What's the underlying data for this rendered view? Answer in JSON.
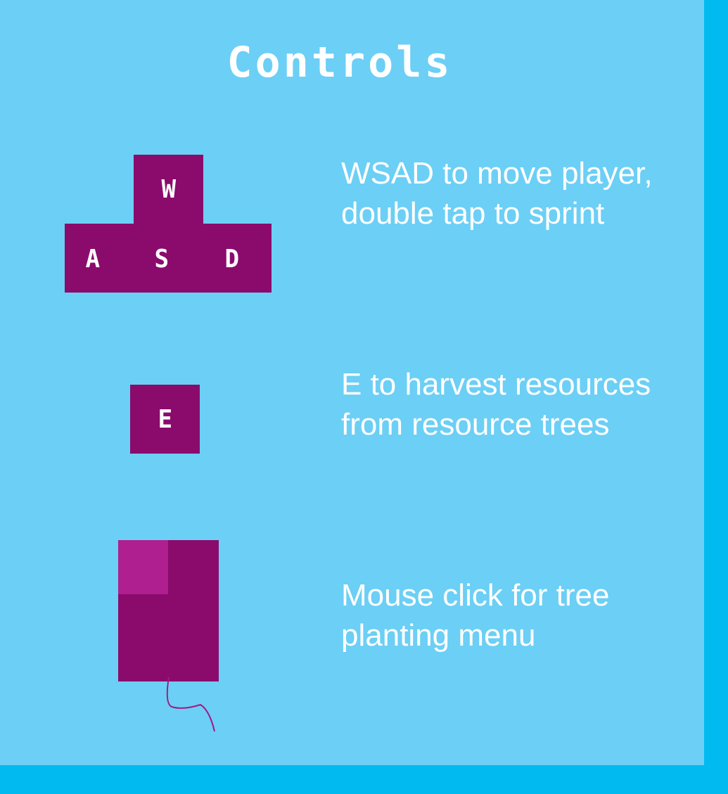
{
  "title": "Controls",
  "colors": {
    "background": "#6ccff5",
    "border": "#00baf0",
    "key": "#8b0b6c",
    "mouse_button": "#af1f8f",
    "text": "#ffffff"
  },
  "controls": [
    {
      "icon": "wasd-keys-icon",
      "keys": [
        "W",
        "A",
        "S",
        "D"
      ],
      "description": "WSAD to move player, double tap to sprint"
    },
    {
      "icon": "e-key-icon",
      "keys": [
        "E"
      ],
      "description": "E to harvest resources from resource trees"
    },
    {
      "icon": "mouse-icon",
      "keys": [],
      "description": "Mouse click for tree planting menu"
    }
  ]
}
